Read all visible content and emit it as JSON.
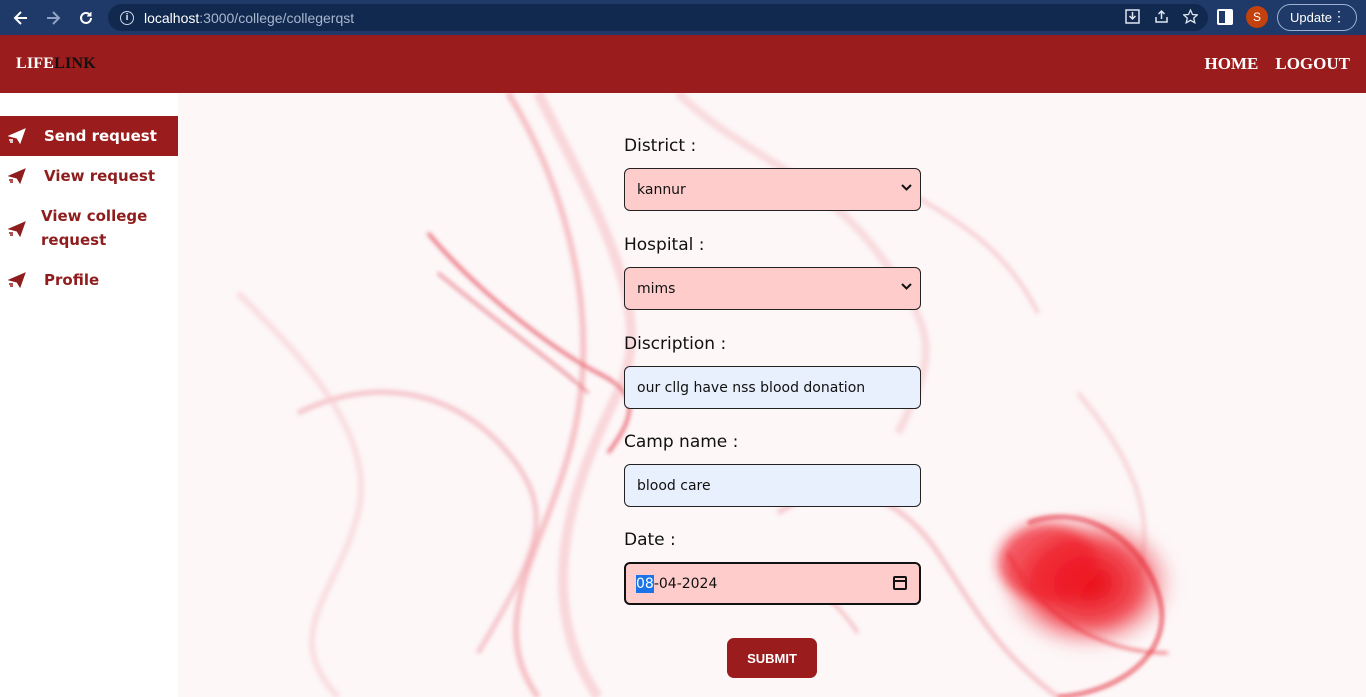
{
  "browser": {
    "url_host": "localhost",
    "url_path": ":3000/college/collegerqst",
    "profile_initial": "S",
    "update_label": "Update"
  },
  "header": {
    "logo_part1": "LIFE",
    "logo_part2": "LINK",
    "nav": [
      "HOME",
      "LOGOUT"
    ]
  },
  "sidebar": {
    "items": [
      {
        "label": "Send request",
        "active": true
      },
      {
        "label": "View request",
        "active": false
      },
      {
        "label": "View college request",
        "active": false
      },
      {
        "label": "Profile",
        "active": false
      }
    ]
  },
  "form": {
    "district_label": "District :",
    "district_value": "kannur",
    "hospital_label": "Hospital :",
    "hospital_value": "mims",
    "description_label": "Discription :",
    "description_value": "our cllg have nss blood donation",
    "camp_label": "Camp name :",
    "camp_value": "blood care",
    "date_label": "Date :",
    "date_day": "08",
    "date_rest": "-04-2024",
    "submit_label": "SUBMIT"
  },
  "colors": {
    "brand": "#9b1c1c",
    "select_bg": "#ffcccc",
    "input_bg": "#e8f0fe"
  }
}
